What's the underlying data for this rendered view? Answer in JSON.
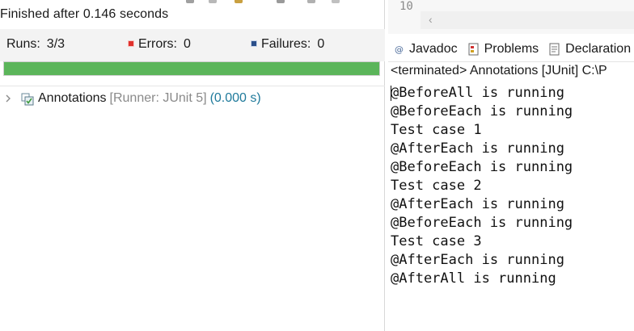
{
  "junit": {
    "status_text": "Finished after 0.146 seconds",
    "runs_label": "Runs:",
    "runs_value": "3/3",
    "errors_label": "Errors:",
    "errors_value": "0",
    "failures_label": "Failures:",
    "failures_value": "0",
    "progress_fraction": 1.0,
    "progress_color": "#5bb55a",
    "tree": {
      "suite_name": "Annotations",
      "runner": "[Runner: JUnit 5]",
      "elapsed": "(0.000 s)"
    }
  },
  "editor": {
    "line_number": "10"
  },
  "tabs": [
    {
      "label": "Javadoc",
      "icon": "at-icon"
    },
    {
      "label": "Problems",
      "icon": "problems-icon"
    },
    {
      "label": "Declaration",
      "icon": "declaration-icon"
    }
  ],
  "console": {
    "header": "<terminated> Annotations [JUnit] C:\\P",
    "lines": [
      "@BeforeAll is running",
      "@BeforeEach is running",
      "Test case 1",
      "@AfterEach is running",
      "@BeforeEach is running",
      "Test case 2",
      "@AfterEach is running",
      "@BeforeEach is running",
      "Test case 3",
      "@AfterEach is running",
      "@AfterAll is running"
    ]
  }
}
